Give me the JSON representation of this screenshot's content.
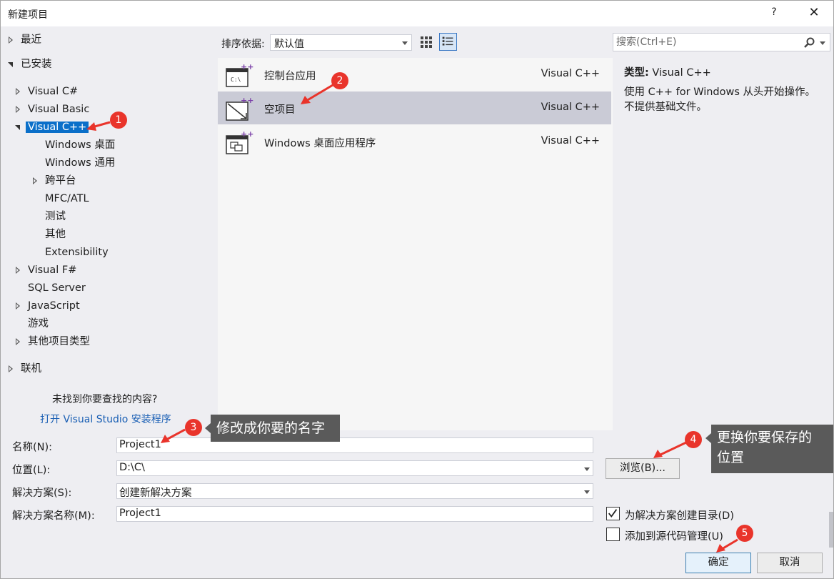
{
  "window": {
    "title": "新建项目",
    "help": "?",
    "close": "✕"
  },
  "tree": {
    "recent": "最近",
    "installed": "已安装",
    "items": [
      {
        "label": "Visual C#"
      },
      {
        "label": "Visual Basic"
      },
      {
        "label": "Visual C++"
      },
      {
        "label": "Windows 桌面"
      },
      {
        "label": "Windows 通用"
      },
      {
        "label": "跨平台"
      },
      {
        "label": "MFC/ATL"
      },
      {
        "label": "测试"
      },
      {
        "label": "其他"
      },
      {
        "label": "Extensibility"
      },
      {
        "label": "Visual F#"
      },
      {
        "label": "SQL Server"
      },
      {
        "label": "JavaScript"
      },
      {
        "label": "游戏"
      },
      {
        "label": "其他项目类型"
      }
    ],
    "online": "联机",
    "not_found": "未找到你要查找的内容?",
    "open_installer": "打开 Visual Studio 安装程序"
  },
  "toolbar": {
    "sort_label": "排序依据:",
    "sort_value": "默认值"
  },
  "templates": [
    {
      "name": "控制台应用",
      "lang": "Visual C++",
      "icon_text": "C:\\"
    },
    {
      "name": "空项目",
      "lang": "Visual C++"
    },
    {
      "name": "Windows 桌面应用程序",
      "lang": "Visual C++"
    }
  ],
  "search": {
    "placeholder": "搜索(Ctrl+E)"
  },
  "description": {
    "type_label": "类型:",
    "type_value": "Visual C++",
    "line1": "使用 C++ for Windows 从头开始操作。",
    "line2": "不提供基础文件。"
  },
  "form": {
    "name_label": "名称(N):",
    "name_value": "Project1",
    "location_label": "位置(L):",
    "location_value": "D:\\C\\",
    "solution_label": "解决方案(S):",
    "solution_value": "创建新解决方案",
    "solution_name_label": "解决方案名称(M):",
    "solution_name_value": "Project1",
    "browse": "浏览(B)...",
    "create_dir": "为解决方案创建目录(D)",
    "add_source": "添加到源代码管理(U)",
    "ok": "确定",
    "cancel": "取消"
  },
  "annotations": {
    "b1": "1",
    "b2": "2",
    "b3": "3",
    "b4": "4",
    "b5": "5",
    "callout3": "修改成你要的名字",
    "callout4_l1": "更换你要保存的",
    "callout4_l2": "位置"
  },
  "colors": {
    "annotation_red": "#e9342b",
    "selection_blue": "#0a6fc9",
    "callout_gray": "#5a5a5a"
  }
}
